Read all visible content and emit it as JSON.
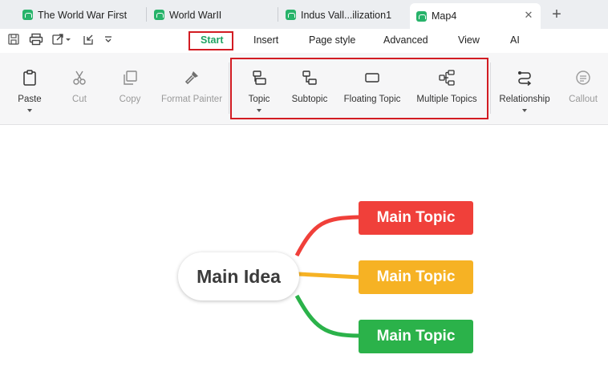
{
  "tabs": [
    {
      "label": "The World War First"
    },
    {
      "label": "World WarII"
    },
    {
      "label": "Indus Vall...ilization1"
    },
    {
      "label": "Map4",
      "active": true
    }
  ],
  "tab_close": "✕",
  "new_tab": "+",
  "menu": {
    "items": [
      "Start",
      "Insert",
      "Page style",
      "Advanced",
      "View",
      "AI"
    ],
    "active": "Start"
  },
  "ribbon": {
    "paste": "Paste",
    "cut": "Cut",
    "copy": "Copy",
    "format_painter": "Format Painter",
    "topic": "Topic",
    "subtopic": "Subtopic",
    "floating_topic": "Floating Topic",
    "multiple_topics": "Multiple Topics",
    "relationship": "Relationship",
    "callout": "Callout"
  },
  "mindmap": {
    "main_idea": "Main Idea",
    "topics": [
      {
        "label": "Main Topic",
        "color": "#f0403a"
      },
      {
        "label": "Main Topic",
        "color": "#f6b224"
      },
      {
        "label": "Main Topic",
        "color": "#2bb24a"
      }
    ]
  },
  "colors": {
    "accent": "#1fa463",
    "highlight_box": "#d21c23",
    "app_icon": "#27b36a"
  }
}
